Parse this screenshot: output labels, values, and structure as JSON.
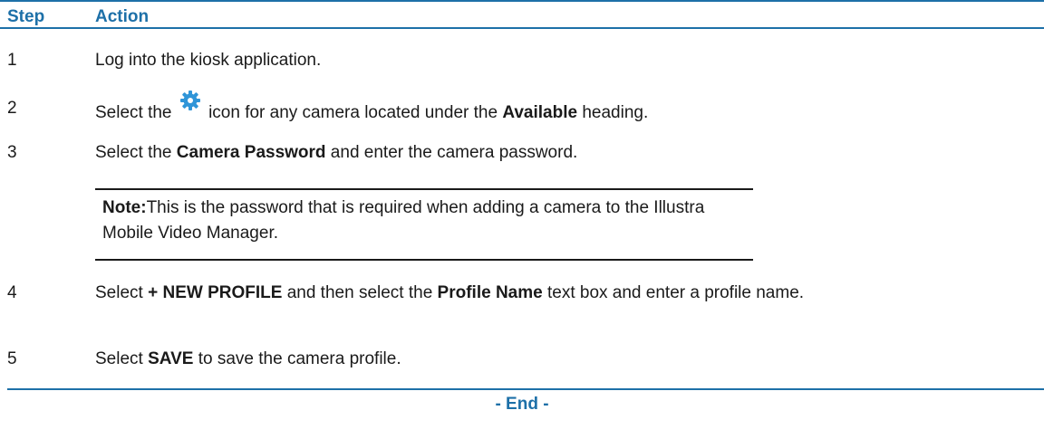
{
  "table": {
    "headers": {
      "step": "Step",
      "action": "Action"
    },
    "rows": [
      {
        "num": "1",
        "parts": [
          "Log into the kiosk application."
        ]
      },
      {
        "num": "2",
        "parts": [
          "Select the",
          "icon for any camera located under the ",
          "Available",
          " heading."
        ]
      },
      {
        "num": "3",
        "parts": [
          "Select the ",
          "Camera Password",
          " and enter the camera password."
        ]
      },
      {
        "num": "4",
        "parts": [
          "Select ",
          "+ NEW PROFILE",
          " and then select the ",
          "Profile Name",
          " text box and enter a profile name."
        ]
      },
      {
        "num": "5",
        "parts": [
          "Select ",
          "SAVE",
          " to save the camera profile."
        ]
      }
    ]
  },
  "note": {
    "label": "Note:",
    "text": "This is the password that is required when adding a camera to the Illustra Mobile Video Manager."
  },
  "footer": {
    "end_label": "- End -"
  },
  "icons": {
    "gear": "gear-icon"
  },
  "colors": {
    "accent": "#1d70a8",
    "icon": "#2f95d8"
  }
}
